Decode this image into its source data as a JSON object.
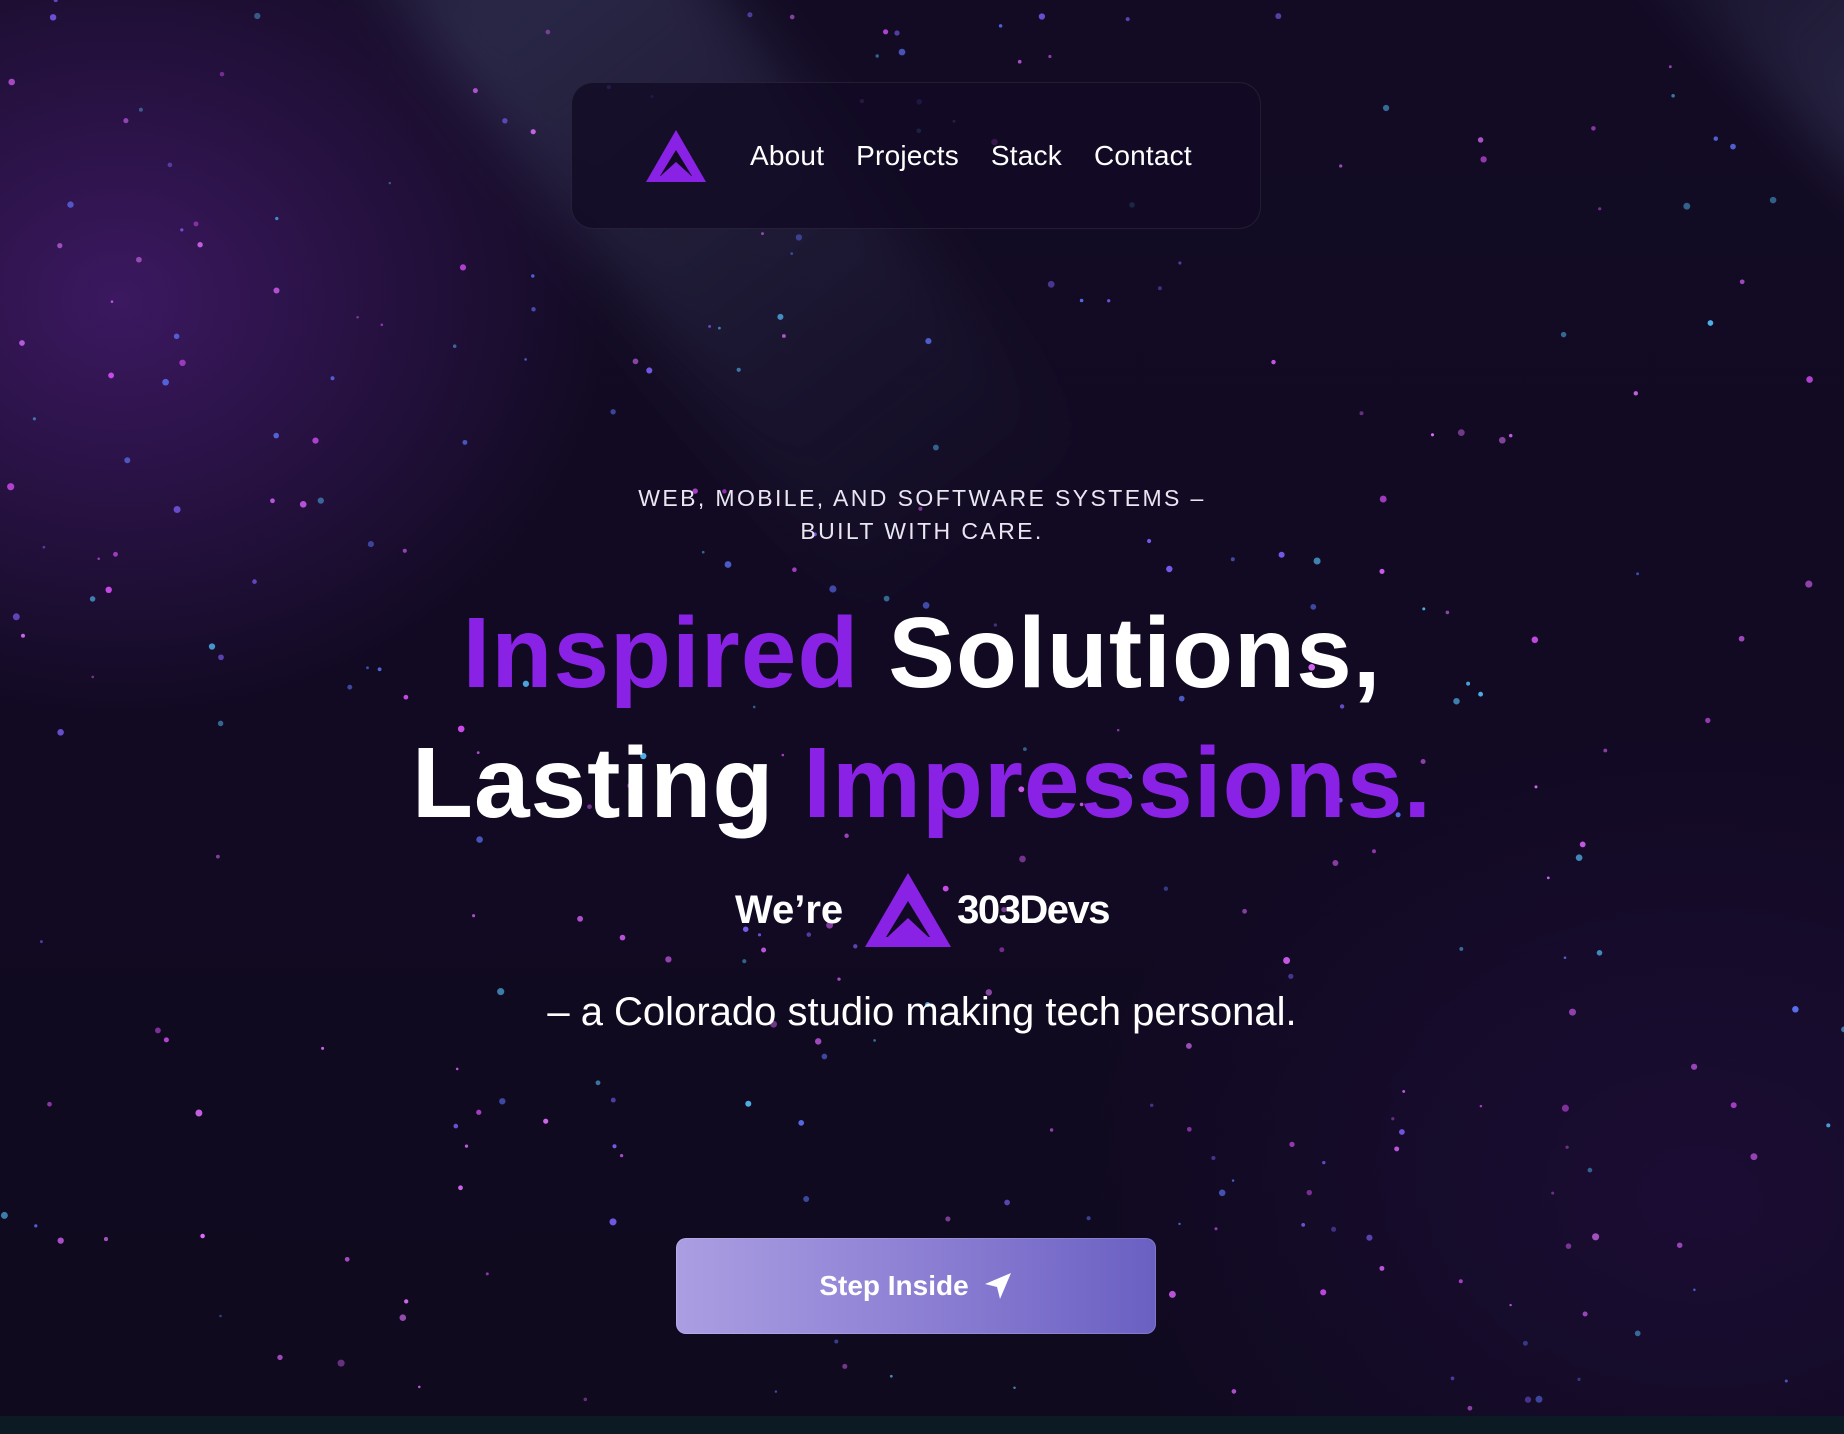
{
  "nav": {
    "logo_icon": "303devs-mountain-logo-icon",
    "links": [
      {
        "label": "About"
      },
      {
        "label": "Projects"
      },
      {
        "label": "Stack"
      },
      {
        "label": "Contact"
      }
    ]
  },
  "hero": {
    "eyebrow_line1": "WEB, MOBILE, AND SOFTWARE SYSTEMS –",
    "eyebrow_line2": "BUILT WITH CARE.",
    "headline": {
      "line1_accent": "Inspired",
      "line1_rest": "Solutions,",
      "line2_start": "Lasting",
      "line2_accent": "Impressions."
    },
    "were_label": "We’re",
    "brand_name": "303Devs",
    "tagline": "– a Colorado studio making tech personal."
  },
  "cta": {
    "label": "Step Inside",
    "icon": "navigation-arrow-icon"
  },
  "colors": {
    "background": "#110a22",
    "accent_purple": "#8a22e6",
    "cta_gradient_start": "#ab9ee2",
    "cta_gradient_end": "#6a60c2"
  }
}
